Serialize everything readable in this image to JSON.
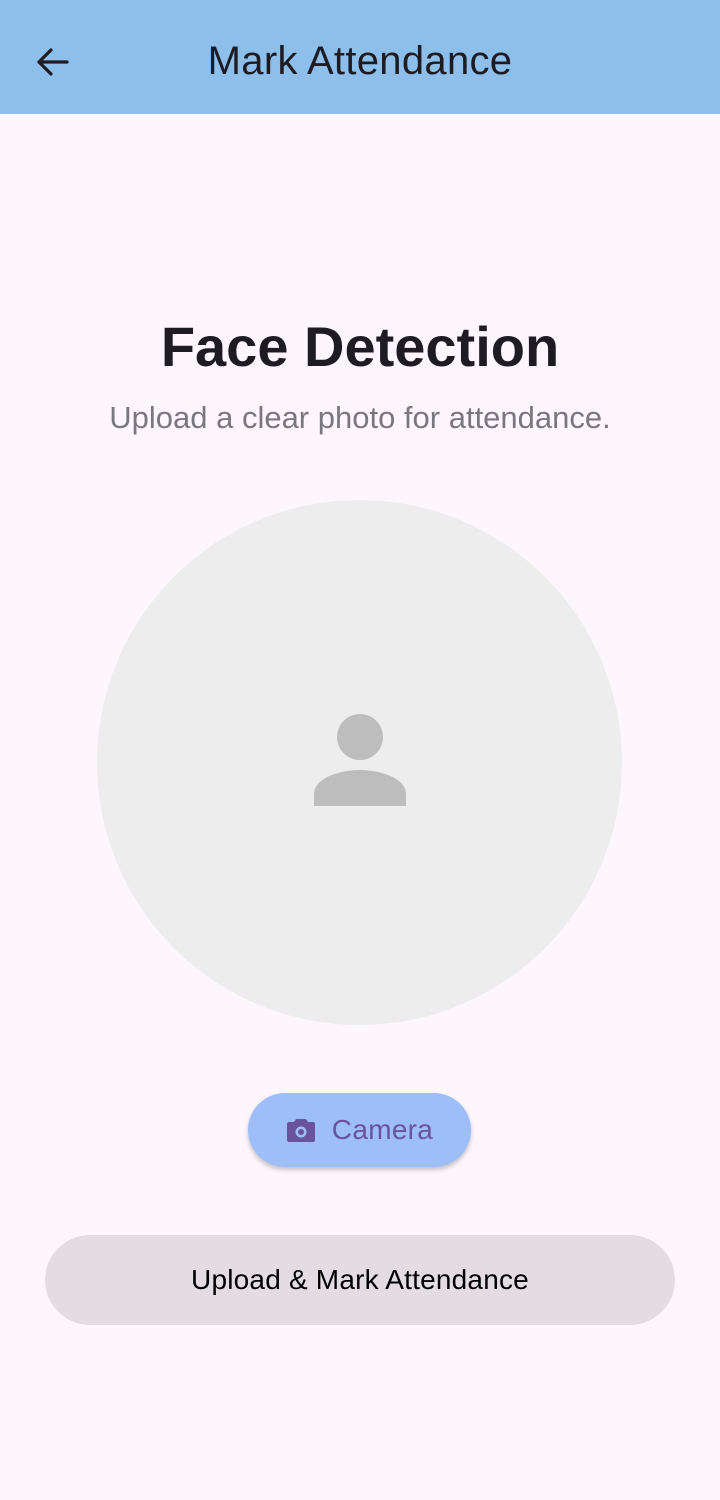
{
  "app_bar": {
    "title": "Mark Attendance",
    "back_icon": "arrow-left-icon",
    "background": "#8DBFEA"
  },
  "main": {
    "title": "Face Detection",
    "subtitle": "Upload a clear photo for attendance.",
    "placeholder_icon": "person-icon"
  },
  "actions": {
    "camera_label": "Camera",
    "camera_icon": "camera-icon",
    "camera_color": "#9DBEF9",
    "upload_label": "Upload & Mark Attendance",
    "upload_color": "#E3DDE3"
  }
}
